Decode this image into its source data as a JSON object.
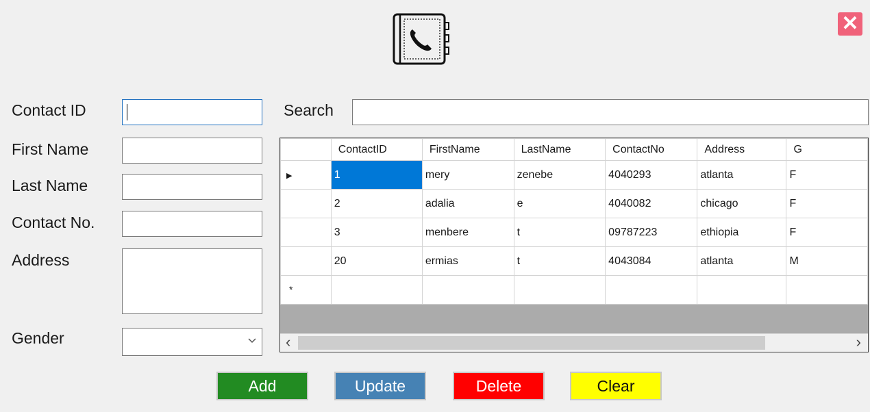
{
  "window": {
    "close_glyph": "✕",
    "app_icon": "phonebook-icon"
  },
  "form": {
    "contact_id_label": "Contact ID",
    "first_name_label": "First Name",
    "last_name_label": "Last Name",
    "contact_no_label": "Contact No.",
    "address_label": "Address",
    "gender_label": "Gender",
    "contact_id_value": "",
    "first_name_value": "",
    "last_name_value": "",
    "contact_no_value": "",
    "address_value": "",
    "gender_value": ""
  },
  "search": {
    "label": "Search",
    "value": ""
  },
  "grid": {
    "columns": [
      "ContactID",
      "FirstName",
      "LastName",
      "ContactNo",
      "Address",
      "G"
    ],
    "rows": [
      [
        "1",
        "mery",
        "zenebe",
        "4040293",
        "atlanta",
        "F"
      ],
      [
        "2",
        "adalia",
        "e",
        "4040082",
        "chicago",
        "F"
      ],
      [
        "3",
        "menbere",
        "t",
        "09787223",
        "ethiopia",
        "F"
      ],
      [
        "20",
        "ermias",
        "t",
        "4043084",
        "atlanta",
        "M"
      ]
    ],
    "current_row_marker": "▶",
    "new_row_marker": "*",
    "scroll_left": "‹",
    "scroll_right": "›"
  },
  "buttons": {
    "add": "Add",
    "update": "Update",
    "delete": "Delete",
    "clear": "Clear"
  },
  "colors": {
    "add": "#228b22",
    "update": "#4682b4",
    "delete": "#ff0000",
    "clear": "#ffff00",
    "selection": "#0078d7",
    "close": "#f0627a"
  }
}
